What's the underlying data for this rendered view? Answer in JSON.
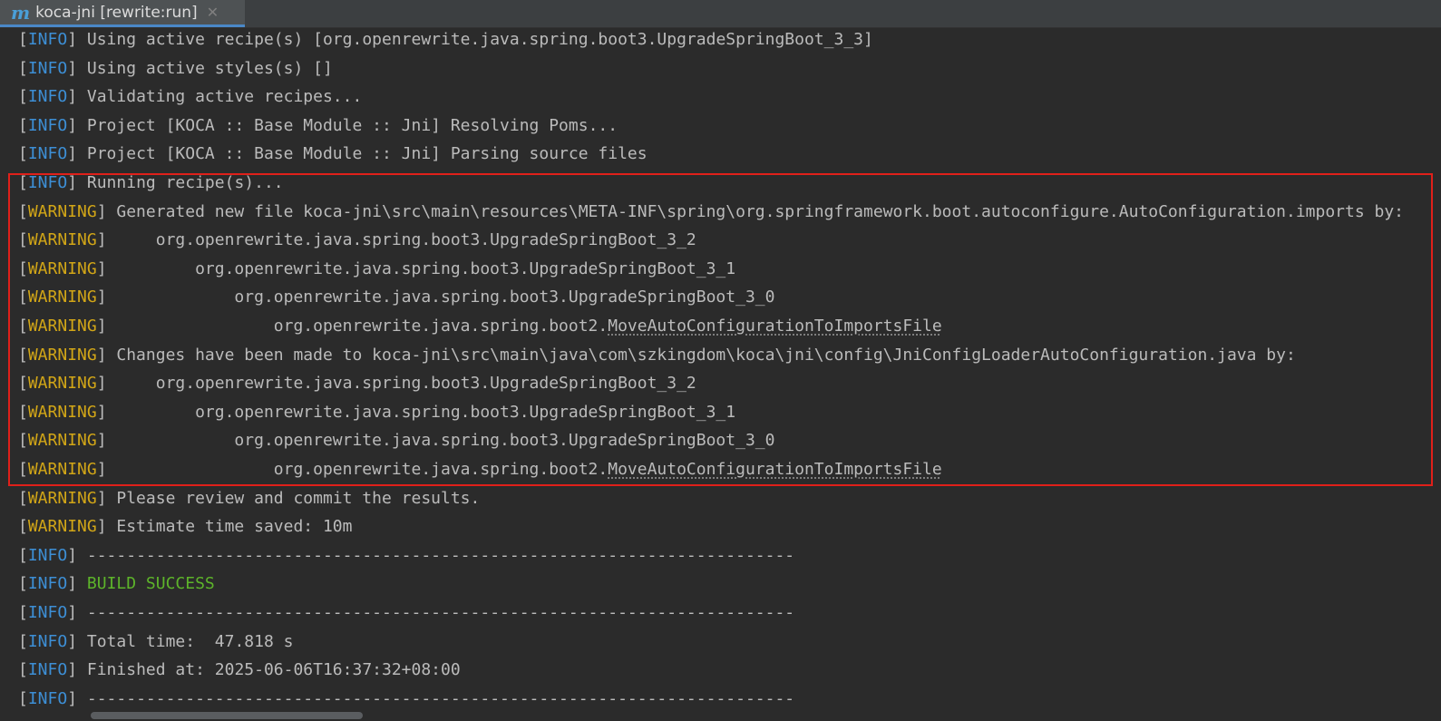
{
  "tab": {
    "icon_letter": "m",
    "label": "koca-jni [rewrite:run]",
    "close_glyph": "✕"
  },
  "colors": {
    "info": "#3d8fd6",
    "warning": "#d2a617",
    "success": "#5db42a",
    "text": "#bbbbbb",
    "highlight_border": "#e0201a",
    "background": "#2b2b2b"
  },
  "lines": [
    {
      "level": "INFO",
      "text": " Using active recipe(s) [org.openrewrite.java.spring.boot3.UpgradeSpringBoot_3_3]"
    },
    {
      "level": "INFO",
      "text": " Using active styles(s) []"
    },
    {
      "level": "INFO",
      "text": " Validating active recipes..."
    },
    {
      "level": "INFO",
      "text": " Project [KOCA :: Base Module :: Jni] Resolving Poms..."
    },
    {
      "level": "INFO",
      "text": " Project [KOCA :: Base Module :: Jni] Parsing source files"
    },
    {
      "level": "INFO",
      "text": " Running recipe(s)..."
    },
    {
      "level": "WARNING",
      "text": " Generated new file koca-jni\\src\\main\\resources\\META-INF\\spring\\org.springframework.boot.autoconfigure.AutoConfiguration.imports by:"
    },
    {
      "level": "WARNING",
      "text": "     org.openrewrite.java.spring.boot3.UpgradeSpringBoot_3_2"
    },
    {
      "level": "WARNING",
      "text": "         org.openrewrite.java.spring.boot3.UpgradeSpringBoot_3_1"
    },
    {
      "level": "WARNING",
      "text": "             org.openrewrite.java.spring.boot3.UpgradeSpringBoot_3_0"
    },
    {
      "level": "WARNING",
      "text": "                 org.openrewrite.java.spring.boot2.",
      "link": "MoveAutoConfigurationToImportsFile"
    },
    {
      "level": "WARNING",
      "text": " Changes have been made to koca-jni\\src\\main\\java\\com\\szkingdom\\koca\\jni\\config\\JniConfigLoaderAutoConfiguration.java by:"
    },
    {
      "level": "WARNING",
      "text": "     org.openrewrite.java.spring.boot3.UpgradeSpringBoot_3_2"
    },
    {
      "level": "WARNING",
      "text": "         org.openrewrite.java.spring.boot3.UpgradeSpringBoot_3_1"
    },
    {
      "level": "WARNING",
      "text": "             org.openrewrite.java.spring.boot3.UpgradeSpringBoot_3_0"
    },
    {
      "level": "WARNING",
      "text": "                 org.openrewrite.java.spring.boot2.",
      "link": "MoveAutoConfigurationToImportsFile"
    },
    {
      "level": "WARNING",
      "text": " Please review and commit the results."
    },
    {
      "level": "WARNING",
      "text": " Estimate time saved: 10m"
    },
    {
      "level": "INFO",
      "text": " ------------------------------------------------------------------------"
    },
    {
      "level": "INFO",
      "text": " ",
      "success": "BUILD SUCCESS"
    },
    {
      "level": "INFO",
      "text": " ------------------------------------------------------------------------"
    },
    {
      "level": "INFO",
      "text": " Total time:  47.818 s"
    },
    {
      "level": "INFO",
      "text": " Finished at: 2025-06-06T16:37:32+08:00"
    },
    {
      "level": "INFO",
      "text": " ------------------------------------------------------------------------"
    }
  ]
}
